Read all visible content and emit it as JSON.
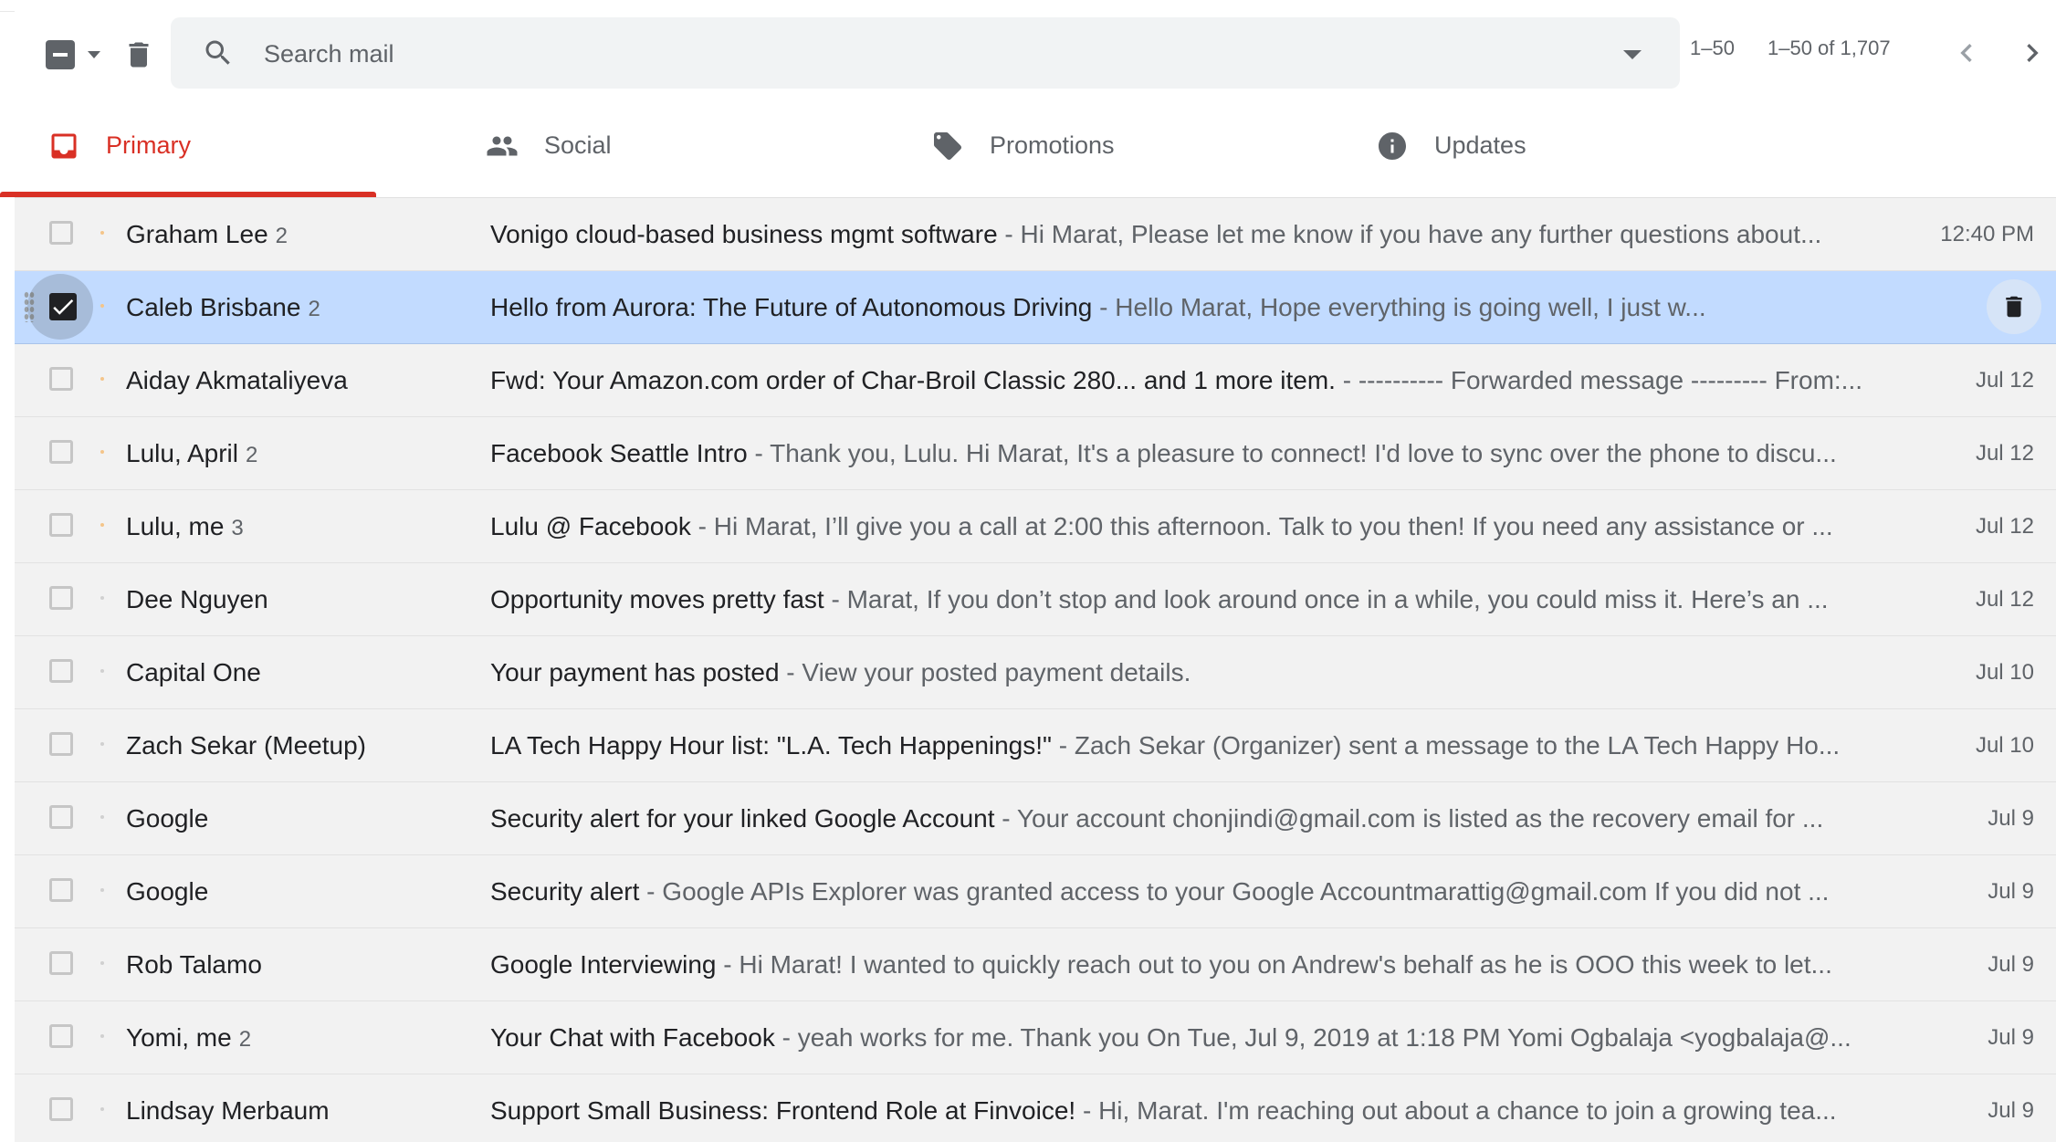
{
  "toolbar": {
    "search_placeholder": "Search mail",
    "pager_short": "1–50",
    "pager_full": "1–50 of 1,707"
  },
  "tabs": [
    {
      "label": "Primary",
      "icon": "inbox-icon",
      "active": true
    },
    {
      "label": "Social",
      "icon": "people-icon",
      "active": false
    },
    {
      "label": "Promotions",
      "icon": "tag-icon",
      "active": false
    },
    {
      "label": "Updates",
      "icon": "info-icon",
      "active": false
    }
  ],
  "colors": {
    "accent_red": "#d93025",
    "selected_row": "#c2dbff",
    "row_bg": "#f2f2f2"
  },
  "emails": [
    {
      "sender": "Graham Lee",
      "count": "2",
      "subject": "Vonigo cloud-based business mgmt software",
      "snippet": " - Hi Marat, Please let me know if you have any further questions about...",
      "date": "12:40 PM",
      "selected": false
    },
    {
      "sender": "Caleb Brisbane",
      "count": "2",
      "subject": "Hello from Aurora: The Future of Autonomous Driving",
      "snippet": " - Hello Marat, Hope everything is going well, I just w...",
      "date": "",
      "selected": true
    },
    {
      "sender": "Aiday Akmataliyeva",
      "count": "",
      "subject": "Fwd: Your Amazon.com order of Char-Broil Classic 280... and 1 more item.",
      "snippet": " - ---------- Forwarded message --------- From:...",
      "date": "Jul 12",
      "selected": false
    },
    {
      "sender": "Lulu, April",
      "count": "2",
      "subject": "Facebook Seattle Intro",
      "snippet": " - Thank you, Lulu. Hi Marat, It's a pleasure to connect! I'd love to sync over the phone to discu...",
      "date": "Jul 12",
      "selected": false
    },
    {
      "sender": "Lulu, me",
      "count": "3",
      "subject": "Lulu @ Facebook",
      "snippet": " - Hi Marat, I’ll give you a call at 2:00 this afternoon. Talk to you then! If you need any assistance or ...",
      "date": "Jul 12",
      "selected": false
    },
    {
      "sender": "Dee Nguyen",
      "count": "",
      "subject": "Opportunity moves pretty fast",
      "snippet": " - Marat, If you don’t stop and look around once in a while, you could miss it. Here’s an ...",
      "date": "Jul 12",
      "selected": false
    },
    {
      "sender": "Capital One",
      "count": "",
      "subject": "Your payment has posted",
      "snippet": " - View your posted payment details.",
      "date": "Jul 10",
      "selected": false
    },
    {
      "sender": "Zach Sekar (Meetup)",
      "count": "",
      "subject": "LA Tech Happy Hour list: \"L.A. Tech Happenings!\"",
      "snippet": " - Zach Sekar (Organizer) sent a message to the LA Tech Happy Ho...",
      "date": "Jul 10",
      "selected": false
    },
    {
      "sender": "Google",
      "count": "",
      "subject": "Security alert for your linked Google Account",
      "snippet": " - Your account chonjindi@gmail.com is listed as the recovery email for ...",
      "date": "Jul 9",
      "selected": false
    },
    {
      "sender": "Google",
      "count": "",
      "subject": "Security alert",
      "snippet": " - Google APIs Explorer was granted access to your Google Accountmarattig@gmail.com If you did not ...",
      "date": "Jul 9",
      "selected": false
    },
    {
      "sender": "Rob Talamo",
      "count": "",
      "subject": "Google Interviewing",
      "snippet": " - Hi Marat! I wanted to quickly reach out to you on Andrew's behalf as he is OOO this week to let...",
      "date": "Jul 9",
      "selected": false
    },
    {
      "sender": "Yomi, me",
      "count": "2",
      "subject": "Your Chat with Facebook",
      "snippet": " - yeah works for me. Thank you On Tue, Jul 9, 2019 at 1:18 PM Yomi Ogbalaja <yogbalaja@...",
      "date": "Jul 9",
      "selected": false
    },
    {
      "sender": "Lindsay Merbaum",
      "count": "",
      "subject": "Support Small Business: Frontend Role at Finvoice!",
      "snippet": " - Hi, Marat. I'm reaching out about a chance to join a growing tea...",
      "date": "Jul 9",
      "selected": false
    }
  ]
}
